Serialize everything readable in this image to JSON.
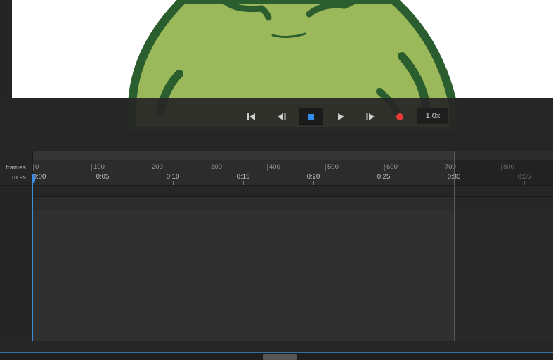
{
  "transport": {
    "buttons": [
      {
        "name": "skip-to-start-icon"
      },
      {
        "name": "step-back-icon"
      },
      {
        "name": "stop-icon"
      },
      {
        "name": "play-icon"
      },
      {
        "name": "step-forward-icon"
      },
      {
        "name": "record-icon"
      }
    ],
    "speed_label": "1.0x",
    "stop_active_color": "#2f8df0",
    "record_color": "#e53935"
  },
  "timeline": {
    "frames_label": "frames",
    "mss_label": "m:ss",
    "frame_ticks": [
      "0",
      "100",
      "200",
      "300",
      "400",
      "500",
      "600",
      "700",
      "800"
    ],
    "time_ticks": [
      "0:00",
      "0:05",
      "0:10",
      "0:15",
      "0:20",
      "0:25",
      "0:30",
      "0:35"
    ],
    "layer_icon": "onion-skin-icon",
    "playhead_color": "#3c8fe0"
  },
  "colors": {
    "frog_fill": "#9bb85a",
    "frog_outline": "#2a5e2f",
    "accent": "#3a6ea8"
  }
}
